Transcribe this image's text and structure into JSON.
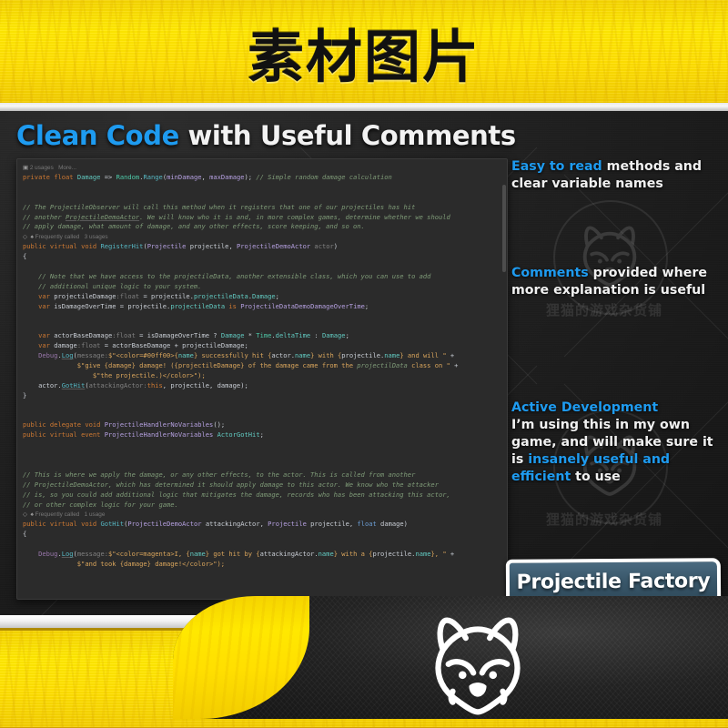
{
  "banner": {
    "title": "素材图片"
  },
  "panel": {
    "headline_accent": "Clean Code",
    "headline_rest": " with Useful Comments"
  },
  "code": {
    "gutter_top": "2 usages   More...",
    "gutter_register": "Frequently called   3 usages",
    "gutter_gothit": "Frequently called   1 usage",
    "lines": [
      "private float Damage => Random.Range(minDamage, maxDamage); // Simple random damage calculation",
      "",
      "// The ProjectileObserver will call this method when it registers that one of our projectiles has hit",
      "// another ProjectileDemoActor. We will know who it is and, in more complex games, determine whether we should",
      "// apply damage, what amount of damage, and any other effects, score keeping, and so on.",
      "public virtual void RegisterHit(Projectile projectile, ProjectileDemoActor actor)",
      "{",
      "    // Note that we have access to the projectileData, another extensible class, which you can use to add",
      "    // additional unique logic to your system.",
      "    var projectileDamage :float = projectile.projectileData.Damage;",
      "    var isDamageOverTime = projectile.projectileData is ProjectileDataDemoDamageOverTime;",
      "",
      "    var actorBaseDamage :float = isDamageOverTime ? Damage * Time.deltaTime : Damage;",
      "    var damage :float = actorBaseDamage + projectileDamage;",
      "    Debug.Log( message: $\"<color=#00ff00>{name} successfully hit {actor.name} with {projectile.name} and will \" +",
      "              $\"give {damage} damage! ({projectileDamage} of the damage came from the projectilData class on \" +",
      "              $\"the projectile.)</color>\");",
      "    actor.GotHit( attackingActor: this, projectile, damage);",
      "}",
      "",
      "public delegate void ProjectileHandlerNoVariables();",
      "public virtual event ProjectileHandlerNoVariables ActorGotHit;",
      "",
      "// This is where we apply the damage, or any other effects, to the actor. This is called from another",
      "// ProjectileDemoActor, which has determined it should apply damage to this actor. We know who the attacker",
      "// is, so you could add additional logic that mitigates the damage, records who has been attacking this actor,",
      "// or other complex logic for your game.",
      "public virtual void GotHit(ProjectileDemoActor attackingActor, Projectile projectile, float damage)",
      "{",
      "    Debug.Log( message: $\"<color=magenta>I, {name} got hit by {attackingActor.name} with a {projectile.name}, \" +",
      "              $\"and took {damage} damage!</color>\");"
    ]
  },
  "side": {
    "block1_accent": "Easy to read",
    "block1_rest": " methods and clear variable names",
    "block2_accent": "Comments",
    "block2_rest": " provided where more explanation is useful",
    "block3_accent": "Active Development",
    "block3_line1": "I’m using this in my own game, and will make sure it is ",
    "block3_accent2": "insanely useful and efficient",
    "block3_line2": " to use"
  },
  "badge": {
    "label": "Projectile Factory"
  },
  "watermark": {
    "text": "狸猫的游戏杂货铺"
  },
  "colors": {
    "accent_blue": "#1e9bf0",
    "banner_yellow": "#ffe800",
    "panel_dark": "#1d1d1d",
    "code_bg": "#2b2b2b",
    "badge_blue": "#3a586b"
  }
}
